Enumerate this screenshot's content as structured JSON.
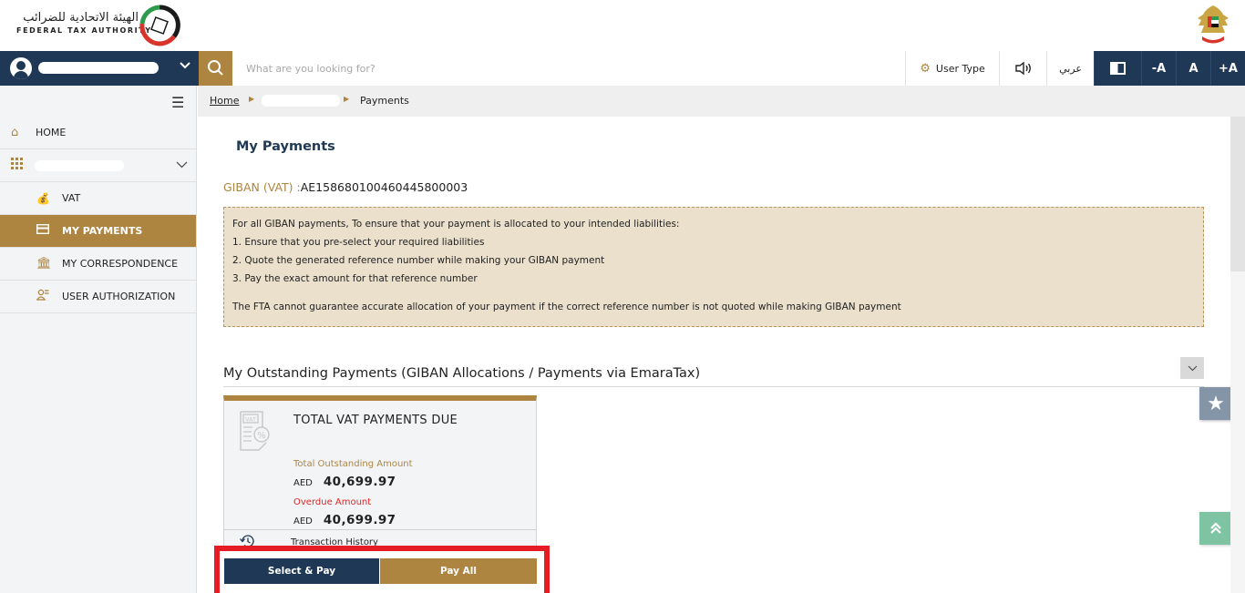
{
  "header": {
    "logo_arabic": "الهيئة الاتحادية للضرائب",
    "logo_english": "FEDERAL TAX AUTHORITY",
    "emblem": "uae-emblem-icon"
  },
  "topbar": {
    "user_name": "[redacted]",
    "search_placeholder": "What are you looking for?",
    "user_type_label": "User Type",
    "language_label": "عربي",
    "font_decrease": "-A",
    "font_normal": "A",
    "font_increase": "+A",
    "icons": {
      "user": "user-avatar-icon",
      "chevron": "chevron-down-icon",
      "search": "search-icon",
      "gear": "gear-icon",
      "speaker": "speaker-icon",
      "contrast": "contrast-icon"
    }
  },
  "sidebar": {
    "items": [
      {
        "label": "HOME",
        "icon": "home-icon"
      },
      {
        "label": "[redacted]",
        "icon": "grid-icon",
        "expandable": true
      },
      {
        "label": "VAT",
        "icon": "money-bag-icon"
      },
      {
        "label": "MY PAYMENTS",
        "icon": "payment-card-icon",
        "active": true
      },
      {
        "label": "MY CORRESPONDENCE",
        "icon": "bank-icon"
      },
      {
        "label": "USER AUTHORIZATION",
        "icon": "user-list-icon"
      }
    ]
  },
  "breadcrumb": {
    "home": "Home",
    "middle": "[redacted]",
    "current": "Payments"
  },
  "main": {
    "title": "My Payments",
    "giban_label": "GIBAN (VAT) :",
    "giban_value": "AE158680100460445800003",
    "notice": {
      "intro": "For all GIBAN payments, To ensure that your payment is allocated to your intended liabilities:",
      "steps": [
        "1. Ensure that you pre-select your required liabilities",
        "2. Quote the generated reference number while making your GIBAN payment",
        "3. Pay the exact amount for that reference number"
      ],
      "warning": "The FTA cannot guarantee accurate allocation of your payment if the correct reference number is not quoted while making GIBAN payment"
    },
    "section_title": "My Outstanding Payments (GIBAN Allocations / Payments via EmaraTax)",
    "card": {
      "title": "TOTAL VAT PAYMENTS DUE",
      "outstanding_label": "Total Outstanding Amount",
      "outstanding_currency": "AED",
      "outstanding_value": "40,699.97",
      "overdue_label": "Overdue Amount",
      "overdue_currency": "AED",
      "overdue_value": "40,699.97",
      "history_label": "Transaction History",
      "select_pay_label": "Select & Pay",
      "pay_all_label": "Pay All"
    }
  },
  "colors": {
    "navy": "#1e3855",
    "gold": "#ad8541",
    "notice_bg": "#ebe0cc",
    "overdue_red": "#e32424",
    "highlight_red": "#e61c24",
    "back_to_top": "#7fc4a2",
    "favorite": "#8595a8"
  }
}
